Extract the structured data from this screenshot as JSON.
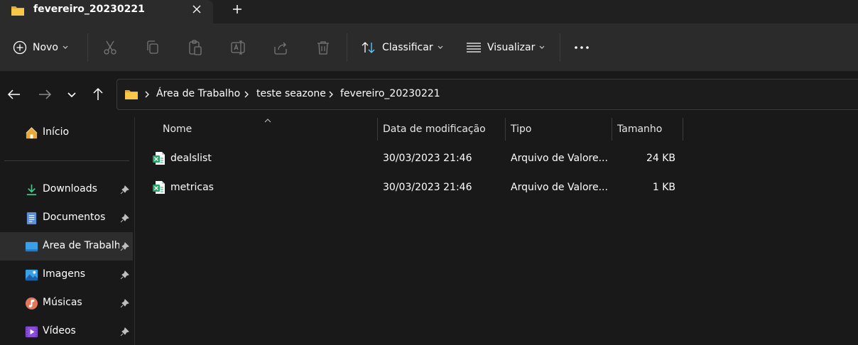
{
  "tab": {
    "title": "fevereiro_20230221"
  },
  "toolbar": {
    "new_label": "Novo",
    "sort_label": "Classificar",
    "view_label": "Visualizar"
  },
  "breadcrumb": [
    "Área de Trabalho",
    "teste seazone",
    "fevereiro_20230221"
  ],
  "sidebar": {
    "items": [
      {
        "label": "Início",
        "icon": "home-icon",
        "pinned": false
      },
      {
        "label": "Downloads",
        "icon": "download-icon",
        "pinned": true
      },
      {
        "label": "Documentos",
        "icon": "document-icon",
        "pinned": true
      },
      {
        "label": "Área de Trabalho",
        "icon": "desktop-icon",
        "pinned": true
      },
      {
        "label": "Imagens",
        "icon": "image-icon",
        "pinned": true
      },
      {
        "label": "Músicas",
        "icon": "music-icon",
        "pinned": true
      },
      {
        "label": "Vídeos",
        "icon": "video-icon",
        "pinned": true
      }
    ]
  },
  "columns": [
    "Nome",
    "Data de modificação",
    "Tipo",
    "Tamanho"
  ],
  "files": [
    {
      "name": "dealslist",
      "modified": "30/03/2023 21:46",
      "type": "Arquivo de Valore...",
      "size": "24 KB",
      "icon": "excel-csv-icon"
    },
    {
      "name": "metricas",
      "modified": "30/03/2023 21:46",
      "type": "Arquivo de Valore...",
      "size": "1 KB",
      "icon": "excel-csv-icon"
    }
  ],
  "colors": {
    "background": "#191919",
    "toolbar": "#2b2b2b",
    "folder": "#f8c74a",
    "accent": "#60cdff",
    "excel": "#21a366"
  }
}
